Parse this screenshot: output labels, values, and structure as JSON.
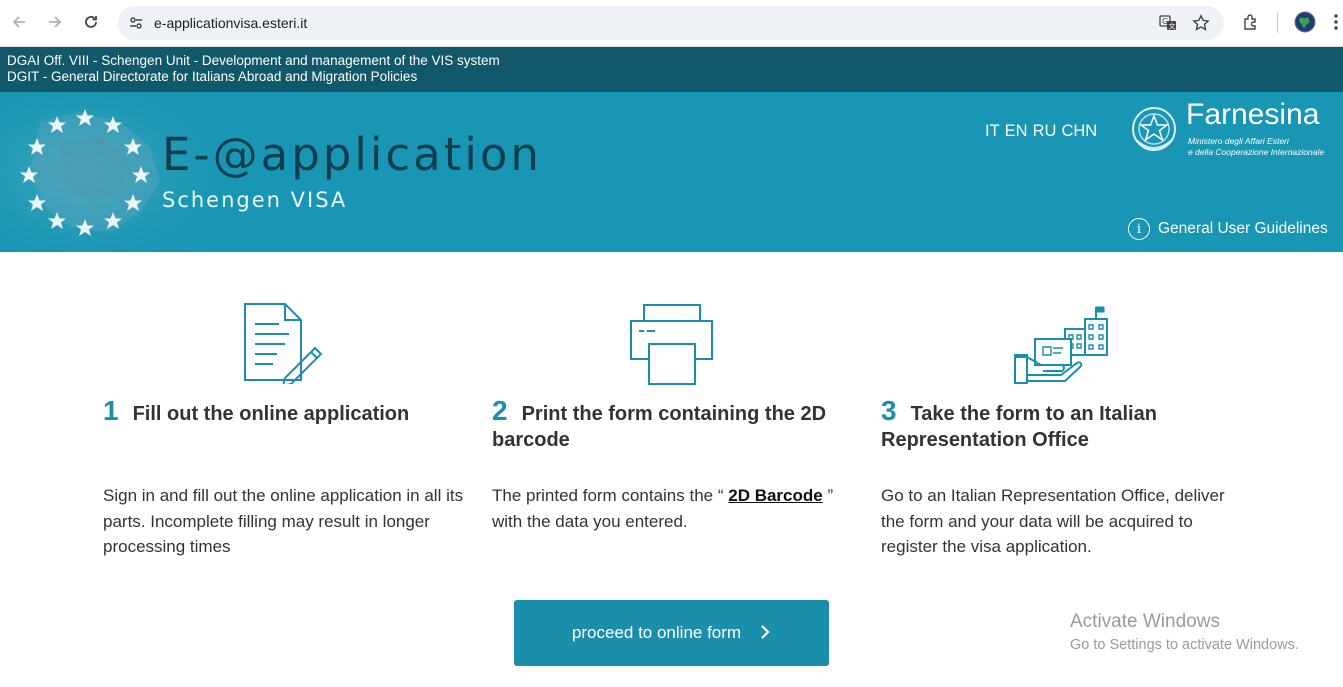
{
  "browser": {
    "url": "e-applicationvisa.esteri.it",
    "icons": [
      "back-arrow-icon",
      "forward-arrow-icon",
      "reload-icon",
      "site-settings-icon",
      "translate-icon",
      "bookmark-star-icon",
      "extensions-icon",
      "profile-avatar-icon",
      "more-menu-icon"
    ]
  },
  "infobar": {
    "line1": "DGAI Off. VIII - Schengen Unit - Development and management of the VIS system",
    "line2": "DGIT - General Directorate for Italians Abroad and Migration Policies"
  },
  "banner": {
    "title": "E-@application",
    "subtitle": "Schengen VISA",
    "languages": [
      "IT",
      "EN",
      "RU",
      "CHN"
    ],
    "logo_name": "Farnesina",
    "logo_sub_line1": "Ministero degli Affari Esteri",
    "logo_sub_line2": "e della Cooperazione Internazionale",
    "guidelines_label": "General User Guidelines",
    "colors": {
      "banner": "#1896b3",
      "infobar": "#11586b",
      "accent": "#1a8eab"
    }
  },
  "steps": [
    {
      "number": "1",
      "title": "Fill out the online application",
      "text": "Sign in and fill out the online application in all its parts. Incomplete filling may result in longer processing times",
      "icon": "document-pencil-icon"
    },
    {
      "number": "2",
      "title": "Print the form containing the 2D barcode",
      "text_before": "The printed form contains the “ ",
      "link": "2D Barcode",
      "text_after": " ” with the data you entered.",
      "icon": "printer-icon"
    },
    {
      "number": "3",
      "title": "Take the form to an Italian Representation Office",
      "text": "Go to an Italian Representation Office, deliver the form and your data will be acquired to register the visa application.",
      "icon": "hand-building-icon"
    }
  ],
  "proceed_label": "proceed to online form",
  "watermark": {
    "line1": "Activate Windows",
    "line2": "Go to Settings to activate Windows."
  }
}
